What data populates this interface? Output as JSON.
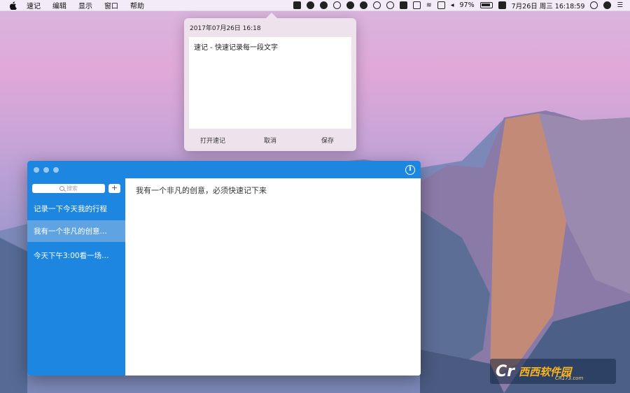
{
  "menubar": {
    "app_name": "速记",
    "menus": [
      "编辑",
      "显示",
      "窗口",
      "帮助"
    ],
    "battery_percent": "97%",
    "datetime": "7月26日 周三  16:18:59"
  },
  "popover": {
    "date": "2017年07月26日 16:18",
    "content": "速记 - 快速记录每一段文字",
    "actions": {
      "open": "打开速记",
      "cancel": "取消",
      "save": "保存"
    }
  },
  "window": {
    "search_placeholder": "搜索",
    "add_label": "+",
    "notes": [
      {
        "title": "记录一下今天我的行程",
        "selected": false
      },
      {
        "title": "我有一个非凡的创意…",
        "selected": true
      },
      {
        "title": "今天下午3:00看一场…",
        "selected": false
      }
    ],
    "editor_text": "我有一个非凡的创意，必须快速记下来",
    "info_icon": "i"
  },
  "watermark": {
    "logo": "Cr",
    "name": "西西软件园",
    "url": "CR173.com"
  },
  "colors": {
    "accent": "#1c86e0",
    "selected_row": "#5fa3e3"
  }
}
